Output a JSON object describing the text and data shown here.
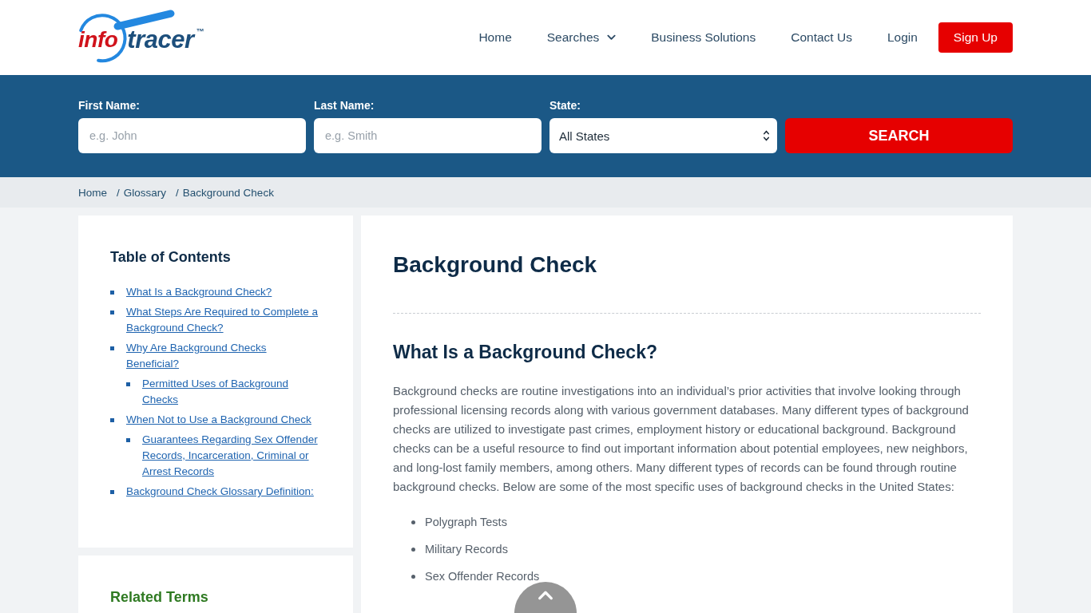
{
  "logo": {
    "text_1": "info",
    "text_2": "tracer",
    "trademark": "™"
  },
  "nav": {
    "items": [
      {
        "label": "Home",
        "kind": "link"
      },
      {
        "label": "Searches",
        "kind": "dropdown"
      },
      {
        "label": "Business Solutions",
        "kind": "link"
      },
      {
        "label": "Contact Us",
        "kind": "link"
      },
      {
        "label": "Login",
        "kind": "link"
      },
      {
        "label": "Sign Up",
        "kind": "button"
      }
    ]
  },
  "search_form": {
    "fields": [
      {
        "label": "First Name:",
        "kind": "text",
        "placeholder": "e.g. John"
      },
      {
        "label": "Last Name:",
        "kind": "text",
        "placeholder": "e.g. Smith"
      },
      {
        "label": "State:",
        "kind": "select",
        "value": "All States"
      }
    ],
    "button": "SEARCH"
  },
  "breadcrumb": {
    "items": [
      {
        "label": "Home"
      },
      {
        "separator": "/",
        "label": "Glossary"
      },
      {
        "separator": "/",
        "label": "Background Check"
      }
    ]
  },
  "toc": {
    "title": "Table of Contents",
    "items": [
      {
        "label": "What Is a Background Check?"
      },
      {
        "label": "What Steps Are Required to Complete a Background Check?"
      },
      {
        "label": "Why Are Background Checks Beneficial?",
        "children": [
          {
            "label": "Permitted Uses of Background Checks"
          }
        ]
      },
      {
        "label": "When Not to Use a Background Check",
        "children": [
          {
            "label": "Guarantees Regarding Sex Offender Records, Incarceration, Criminal or Arrest Records"
          }
        ]
      },
      {
        "label": "Background Check Glossary Definition:"
      }
    ]
  },
  "related": {
    "title": "Related Terms"
  },
  "article": {
    "title": "Background Check",
    "sections": [
      {
        "heading": "What Is a Background Check?",
        "paragraph": "Background checks are routine investigations into an individual’s prior activities that involve looking through professional licensing records along with various government databases. Many different types of background checks are utilized to investigate past crimes, employment history or educational background. Background checks can be a useful resource to find out important information about potential employees, new neighbors, and long-lost family members, among others. Many different types of records can be found through routine background checks. Below are some of the most specific uses of background checks in the United States:",
        "list": [
          "Polygraph Tests",
          "Military Records",
          "Sex Offender Records"
        ]
      }
    ]
  }
}
